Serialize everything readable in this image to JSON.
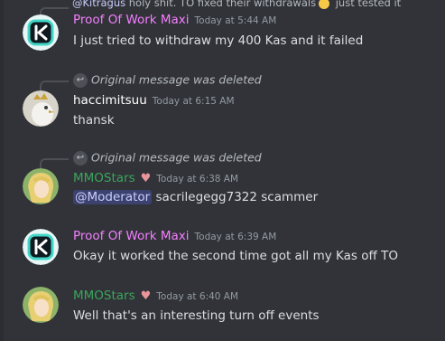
{
  "top_reply": {
    "mention": "@Kitragus",
    "text": " holy shit. TO fixed their withdrawals",
    "text_after_emoji": " just tested it"
  },
  "messages": [
    {
      "author": "Proof Of Work Maxi",
      "author_color": "#f47fff",
      "timestamp": "Today at 5:44 AM",
      "text": "I just tried to withdraw my 400 Kas and it failed"
    },
    {
      "reply_deleted": "Original message was deleted",
      "author": "haccimitsuu",
      "author_color": "#ffffff",
      "timestamp": "Today at 6:15 AM",
      "text": "thansk"
    },
    {
      "reply_deleted": "Original message was deleted",
      "author": "MMOStars",
      "author_color": "#3ba55c",
      "timestamp": "Today at 6:38 AM",
      "mention": "@Moderator",
      "text": " sacrilegegg7322 scammer"
    },
    {
      "author": "Proof Of Work Maxi",
      "author_color": "#f47fff",
      "timestamp": "Today at 6:39 AM",
      "text": "Okay it worked the second time got all my Kas off TO"
    },
    {
      "author": "MMOStars",
      "author_color": "#3ba55c",
      "timestamp": "Today at 6:40 AM",
      "text": "Well that's an interesting turn off events"
    }
  ],
  "icons": {
    "reply": "reply-arrow-icon",
    "badge": "heart-gift-icon"
  }
}
